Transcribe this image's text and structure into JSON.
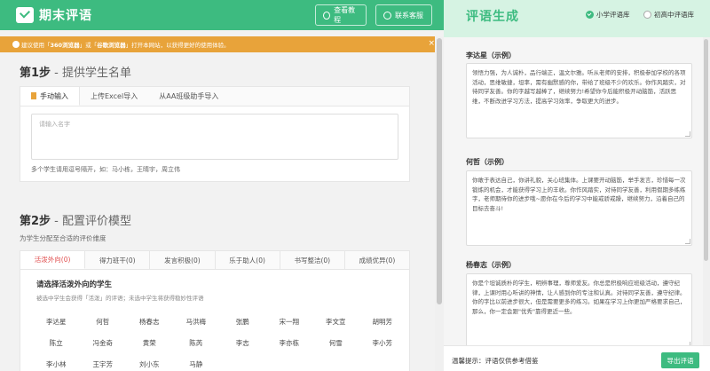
{
  "header": {
    "logo_text": "期末评语",
    "tutorial_label": "查看教程",
    "service_label": "联系客服"
  },
  "notice": {
    "prefix": "建议使用「",
    "browser1": "360浏览器",
    "mid": "」或「",
    "browser2": "谷歌浏览器",
    "suffix": "」打开本网站，以获得更好的使用体验。",
    "close": "×"
  },
  "step1": {
    "num": "第1步",
    "title": " - 提供学生名单",
    "tabs": [
      "手动输入",
      "上传Excel导入",
      "从AA班级助手导入"
    ],
    "placeholder": "请输入名字",
    "hint": "多个学生请用逗号隔开，如：马小栋，王晴宇，周立伟"
  },
  "step2": {
    "num": "第2步",
    "title": " - 配置评价模型",
    "subtitle": "为学生分配至合适的评价维度",
    "tabs": [
      "活泼外向(0)",
      "得力班干(0)",
      "发言积极(0)",
      "乐于助人(0)",
      "书写整洁(0)",
      "成绩优异(0)"
    ],
    "card_title": "请选择活泼外向的学生",
    "card_desc": "被选中学生会获得「活泼」的评语；未选中学生将获得稳妙性评语",
    "students": [
      "李达星",
      "何哲",
      "杨春志",
      "马洪梅",
      "张鹏",
      "宋一翔",
      "李文宣",
      "胡明芳",
      "陈立",
      "冯金奇",
      "黄荣",
      "陈芮",
      "李志",
      "李亦栋",
      "何雪",
      "李小芳",
      "李小林",
      "王宇芳",
      "刘小东",
      "马静",
      "",
      "",
      "",
      ""
    ]
  },
  "right": {
    "title": "评语生成",
    "radio_primary": "小学评语库",
    "radio_junior": "初高中评语库",
    "comments": [
      {
        "name": "李达星（示例）",
        "text": "领悟力强，为人诚朴，品行端正，温文尔雅。听从老师的安排，积极参加学校的各项活动，思维敏捷，坦率，需有幽默感的你，带给了班级不少的欢乐。你作风踏实，对待同学友善。你的字越写越棒了，继续努力!希望你今后能积极开动脑筋，活跃思维，不断改进学习方法，提高学习效率，争取更大的进步。"
      },
      {
        "name": "何哲（示例）",
        "text": "你敢于表达自己，你讲礼貌，关心班集体。上课要开动脑筋，举手发言，珍惜每一次锻炼的机会，才能获得学习上的丰收。你作风踏实，对待同学友善，利用假期多练练字，老师期待你的进步哦~愿你在今后的学习中能戒骄戒躁，继续努力，沿着自己的目标去奋斗!"
      },
      {
        "name": "杨春志（示例）",
        "text": "你是个坦诚质朴的学生，明辨事理，尊师爱友。你总是积极响应班级活动，遵守纪律，上课时用心听讲的神情，让人感到你的专注和认真。对待同学友善，遵守纪律。你的字比以前进步很大，但是需要更多的练习。如果在学习上你更加严格要求自己，那么，你一定会跟\"优秀\"靠得更近一些。"
      }
    ],
    "footer_hint": "温馨提示：评语仅供参考借鉴",
    "export_label": "导出评语"
  }
}
